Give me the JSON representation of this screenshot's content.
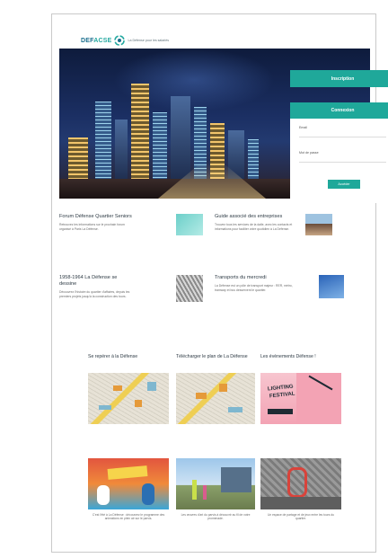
{
  "header": {
    "logo_left": "DEF",
    "logo_right": "ACSE",
    "tagline": "La Défense pour les salariés"
  },
  "hero": {
    "inscription_button": "Inscription",
    "login": {
      "title": "Connexion",
      "email_label": "Email",
      "password_label": "Mot de passe",
      "submit_label": "Accéder"
    }
  },
  "articles": [
    {
      "title": "Forum Défense Quartier Seniors",
      "body": "Retrouvez les informations sur le prochain forum organisé à Paris La Défense."
    },
    {
      "title": "Guide associé des entreprises",
      "body": "Trouvez tous les services de la dalle, avec les contacts et informations pour faciliter votre quotidien à La Défense."
    },
    {
      "title": "1958-1964 La Défense se dessine",
      "body": "Découvrez l'histoire du quartier d'affaires, depuis les premiers projets jusqu'à la construction des tours."
    },
    {
      "title": "Transports du mercredi",
      "body": "La Défense est un pôle de transport majeur : RER, métro, tramway et bus desservent le quartier."
    }
  ],
  "sections": [
    {
      "title": "Se repérer à la Défense"
    },
    {
      "title": "Télécharger le plan de La Défense"
    },
    {
      "title": "Les évènements Défense !"
    }
  ],
  "poster": {
    "headline_1": "LIGHTING",
    "headline_2": "FESTIVAL"
  },
  "photo_cards": [
    {
      "caption": "C'est l'été à La Défense : découvrez le programme des animations en plein air sur le parvis."
    },
    {
      "caption": "Les œuvres d'art du parvis à découvrir au fil de votre promenade."
    },
    {
      "caption": "Un espace de partage et de jeux entre les tours du quartier."
    }
  ],
  "colors": {
    "accent": "#1fa89a",
    "brand": "#1a6e8e"
  }
}
